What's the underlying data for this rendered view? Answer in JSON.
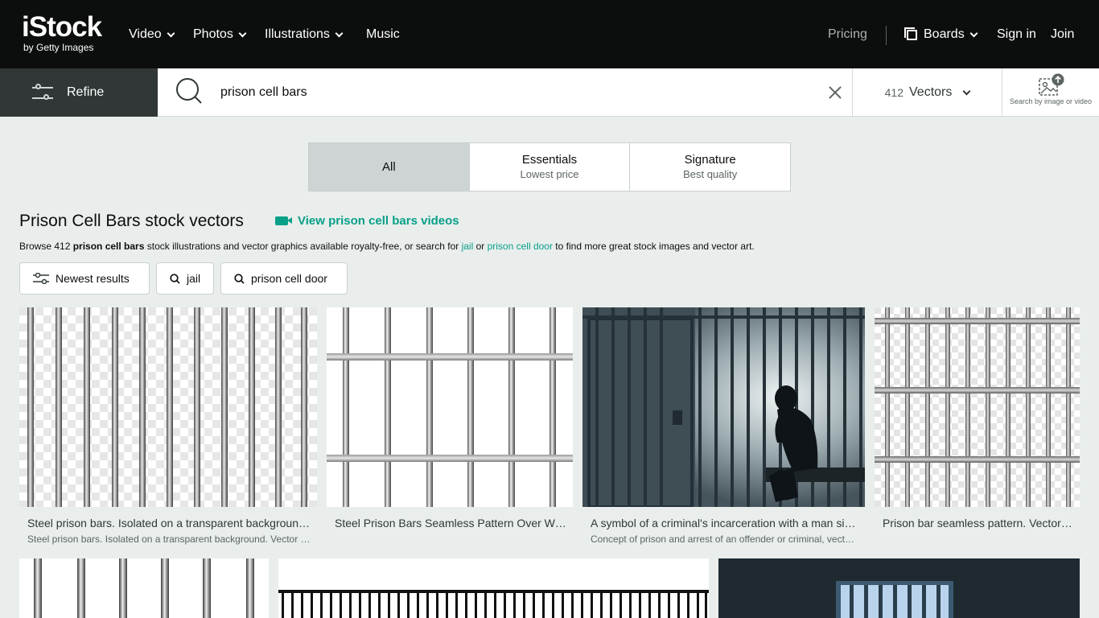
{
  "header": {
    "logo_main": "iStock",
    "logo_sub": "by Getty Images",
    "nav": [
      {
        "label": "Video"
      },
      {
        "label": "Photos"
      },
      {
        "label": "Illustrations"
      },
      {
        "label": "Music"
      }
    ],
    "pricing": "Pricing",
    "boards": "Boards",
    "sign_in": "Sign in",
    "join": "Join"
  },
  "search": {
    "refine_label": "Refine",
    "query": "prison cell bars",
    "result_count": "412",
    "type_label": "Vectors",
    "image_search_label": "Search by image or video"
  },
  "segments": [
    {
      "title": "All",
      "subtitle": ""
    },
    {
      "title": "Essentials",
      "subtitle": "Lowest price"
    },
    {
      "title": "Signature",
      "subtitle": "Best quality"
    }
  ],
  "heading": {
    "title": "Prison Cell Bars stock vectors",
    "video_link": "View prison cell bars videos",
    "desc_prefix": "Browse 412 ",
    "desc_bold": "prison cell bars",
    "desc_mid": " stock illustrations and vector graphics available royalty-free, or search for ",
    "desc_link1": "jail",
    "desc_or": " or ",
    "desc_link2": "prison cell door",
    "desc_suffix": " to find more great stock images and vector art."
  },
  "chips": {
    "sort": "Newest results",
    "related1": "jail",
    "related2": "prison cell door"
  },
  "results": [
    {
      "title": "Steel prison bars. Isolated on a transparent background. Vector illustration.",
      "desc": "Steel prison bars. Isolated on a transparent background. Vector illustration."
    },
    {
      "title": "Steel Prison Bars Seamless Pattern Over White Background",
      "desc": ""
    },
    {
      "title": "A symbol of a criminal's incarceration with a man sitting in a prison cell.",
      "desc": "Concept of prison and arrest of an offender or criminal, vector illustration."
    },
    {
      "title": "Prison bar seamless pattern. Vector illustration.",
      "desc": ""
    }
  ],
  "colors": {
    "accent": "#08a088",
    "header_bg": "#0c0d0d",
    "page_bg": "#e9eeed",
    "refine_bg": "#313737"
  }
}
